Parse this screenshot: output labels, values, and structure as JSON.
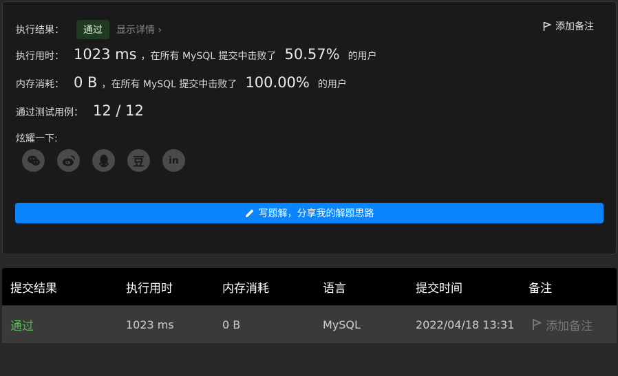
{
  "result": {
    "label": "执行结果：",
    "status": "通过",
    "details": "显示详情 ›",
    "add_note": "添加备注"
  },
  "runtime": {
    "label": "执行用时：",
    "value": "1023 ms",
    "mid": "，在所有 MySQL 提交中击败了",
    "percent": "50.57%",
    "suffix": "的用户"
  },
  "memory": {
    "label": "内存消耗：",
    "value": "0 B",
    "mid": "，在所有 MySQL 提交中击败了",
    "percent": "100.00%",
    "suffix": "的用户"
  },
  "tests": {
    "label": "通过测试用例：",
    "value": "12 / 12"
  },
  "share": {
    "label": "炫耀一下:",
    "icons": [
      "wechat-icon",
      "weibo-icon",
      "qq-icon",
      "douban-icon",
      "linkedin-icon"
    ],
    "douban_glyph": "豆",
    "linkedin_glyph": "in"
  },
  "write_button": "写题解，分享我的解题思路",
  "table": {
    "headers": [
      "提交结果",
      "执行用时",
      "内存消耗",
      "语言",
      "提交时间",
      "备注"
    ],
    "row": {
      "result": "通过",
      "runtime": "1023 ms",
      "memory": "0 B",
      "language": "MySQL",
      "time": "2022/04/18 13:31",
      "note": "添加备注"
    }
  },
  "colors": {
    "accent": "#0a84ff",
    "passed": "#5cb85c"
  }
}
